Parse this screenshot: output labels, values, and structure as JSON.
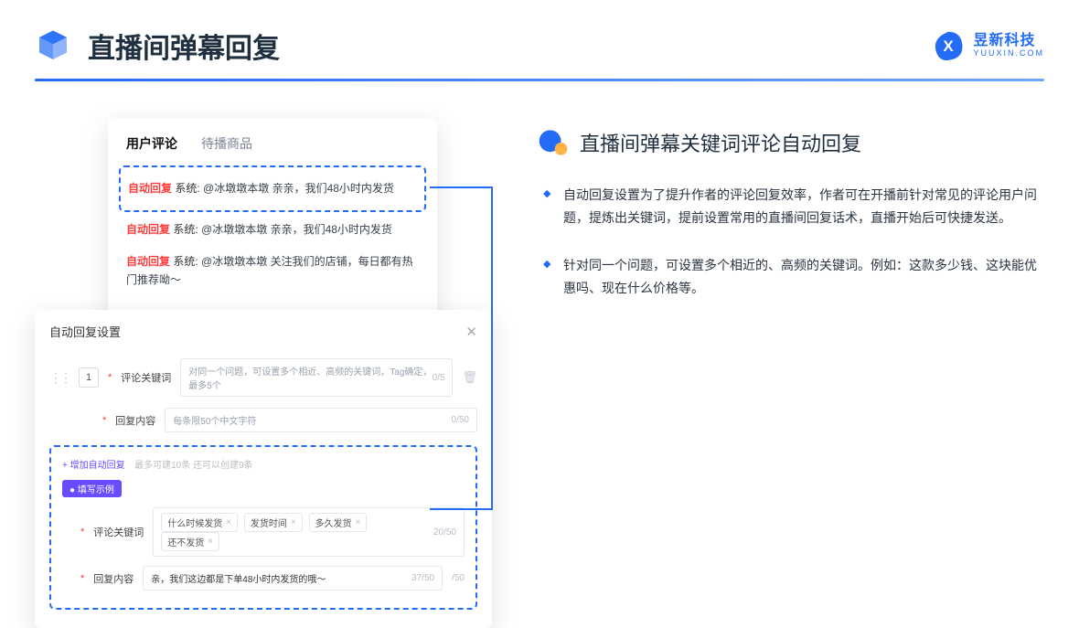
{
  "header": {
    "title": "直播间弹幕回复",
    "brand_cn": "昱新科技",
    "brand_en": "YUUXIN.COM"
  },
  "section": {
    "title": "直播间弹幕关键词评论自动回复",
    "bullets": [
      "自动回复设置为了提升作者的评论回复效率，作者可在开播前针对常见的评论用户问题，提炼出关键词，提前设置常用的直播间回复话术，直播开始后可快捷发送。",
      "针对同一个问题，可设置多个相近的、高频的关键词。例如：这款多少钱、这块能优惠吗、现在什么价格等。"
    ]
  },
  "comments_card": {
    "tab_active": "用户评论",
    "tab_inactive": "待播商品",
    "rows": [
      {
        "tag": "自动回复",
        "sys": "系统:",
        "text": "@冰墩墩本墩 亲亲，我们48小时内发货"
      },
      {
        "tag": "自动回复",
        "sys": "系统:",
        "text": "@冰墩墩本墩 亲亲，我们48小时内发货"
      },
      {
        "tag": "自动回复",
        "sys": "系统:",
        "text": "@冰墩墩本墩 关注我们的店铺，每日都有热门推荐呦～"
      }
    ]
  },
  "settings_card": {
    "title": "自动回复设置",
    "rownum": "1",
    "label_keyword": "评论关键词",
    "placeholder_keyword": "对同一个问题，可设置多个相近、高频的关键词，Tag确定，最多5个",
    "counter_keyword": "0/5",
    "label_reply": "回复内容",
    "placeholder_reply": "每条限50个中文字符",
    "counter_reply": "0/50",
    "add_link": "+ 增加自动回复",
    "add_hint": "最多可建10条 还可以创建9条",
    "example_badge": "● 填写示例",
    "ex_label_keyword": "评论关键词",
    "chips": [
      "什么时候发货",
      "发货时间",
      "多久发货",
      "还不发货"
    ],
    "ex_counter_kw": "20/50",
    "ex_label_reply": "回复内容",
    "ex_reply_value": "亲，我们这边都是下单48小时内发货的哦～",
    "ex_counter_reply": "37/50",
    "ex_counter_tail": "/50"
  }
}
